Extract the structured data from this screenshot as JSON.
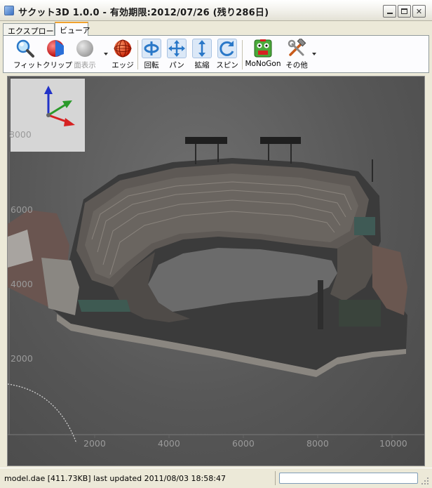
{
  "window": {
    "title": "サクット3D 1.0.0 - 有効期限:2012/07/26 (残り286日)"
  },
  "tabs": [
    {
      "label": "エクスプローラ"
    },
    {
      "label": "ビューア"
    }
  ],
  "toolbar": {
    "fit_label": "フィット",
    "clip_label": "クリップ",
    "faces_label": "面表示",
    "edge_label": "エッジ",
    "rotate_label": "回転",
    "pan_label": "パン",
    "zoom_label": "拡縮",
    "spin_label": "スピン",
    "monogon_label": "MoNoGon",
    "other_label": "その他"
  },
  "viewport": {
    "grid_y_labels": [
      "8000",
      "6000",
      "4000",
      "2000"
    ],
    "grid_x_labels": [
      "2000",
      "4000",
      "6000",
      "8000",
      "10000"
    ]
  },
  "status": {
    "text": "model.dae [411.73KB] last updated 2011/08/03 18:58:47"
  },
  "colors": {
    "accent_tab": "#f0a22f",
    "viewport_bg": "#575757",
    "axis_x": "#d62222",
    "axis_y": "#2a9a2a",
    "axis_z": "#2233c8"
  }
}
